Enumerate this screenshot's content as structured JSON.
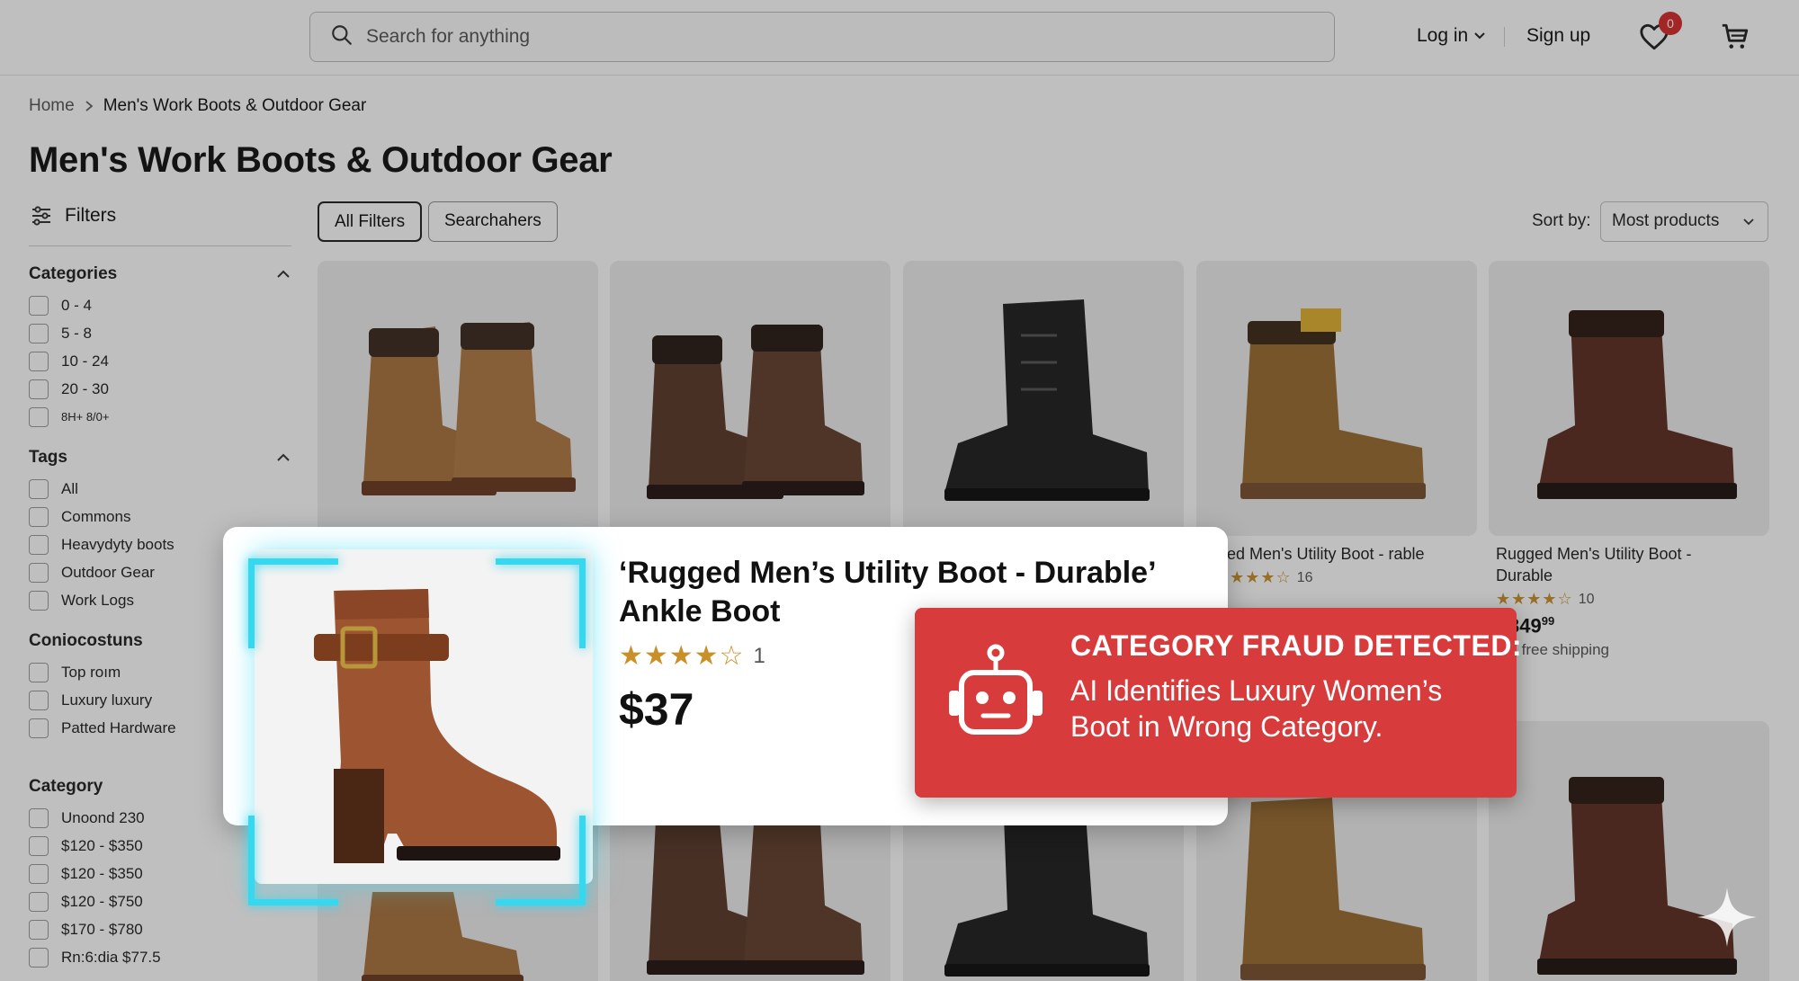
{
  "header": {
    "search_placeholder": "Search for anything",
    "login_label": "Log in",
    "signup_label": "Sign up",
    "wishlist_count": "0"
  },
  "breadcrumb": {
    "home": "Home",
    "current": "Men's Work Boots & Outdoor Gear"
  },
  "page_title": "Men's Work Boots & Outdoor Gear",
  "sidebar": {
    "filters_label": "Filters",
    "groups": [
      {
        "title": "Categories",
        "collapsible": true,
        "options": [
          "0 - 4",
          "5 - 8",
          "10 - 24",
          "20 - 30",
          "8H+ 8/0+"
        ]
      },
      {
        "title": "Tags",
        "collapsible": true,
        "options": [
          "All",
          "Commons",
          "Heavydyty boots",
          "Outdoor Gear",
          "Work Logs"
        ]
      },
      {
        "title": "Coniocostuns",
        "collapsible": false,
        "options": [
          "Top roım",
          "Luxury luxury",
          "Patted Hardware"
        ]
      },
      {
        "title": "Category",
        "collapsible": false,
        "options": [
          "Unoond 230",
          "$120 - $350",
          "$120 - $350",
          "$120 - $750",
          "$170 - $780",
          "Rn:6:dia $77.5"
        ]
      }
    ]
  },
  "toolbar": {
    "chips": [
      "All Filters",
      "Searchahers"
    ],
    "sort_label": "Sort by:",
    "sort_value": "Most products"
  },
  "products": [
    {
      "color": "#a9733f"
    },
    {
      "color": "#5a3a2a"
    },
    {
      "color": "#1f1f1f"
    },
    {
      "color": "#9c6d33",
      "title": "ged Men's Utility Boot - rable",
      "rating": 3.5,
      "reviews": "16"
    },
    {
      "color": "#5e2f22",
      "title": "Rugged Men's Utility Boot - Durable",
      "rating": 3.5,
      "reviews": "10",
      "price_main": "349",
      "price_cents": "99",
      "shipping": "+ free shipping"
    }
  ],
  "bottom_products": [
    {
      "color": "#a9733f"
    },
    {
      "color": "#5a3a2a"
    },
    {
      "color": "#1f1f1f"
    },
    {
      "color": "#9c6d33"
    },
    {
      "color": "#5e2f22"
    }
  ],
  "highlight": {
    "title": "‘Rugged Men’s Utility Boot - Durable’ Ankle Boot",
    "rating": 4,
    "reviews": "1",
    "price": "$37",
    "boot_color": "#9c5530"
  },
  "alert": {
    "heading": "CATEGORY FRAUD DETECTED:",
    "body": "AI Identifies Luxury Women’s Boot in Wrong Category.",
    "color": "#d83b3b",
    "icon": "robot-icon"
  },
  "colors": {
    "accent_cyan": "#36d8ef",
    "badge_red": "#d92b2b",
    "star": "#c9902a"
  }
}
